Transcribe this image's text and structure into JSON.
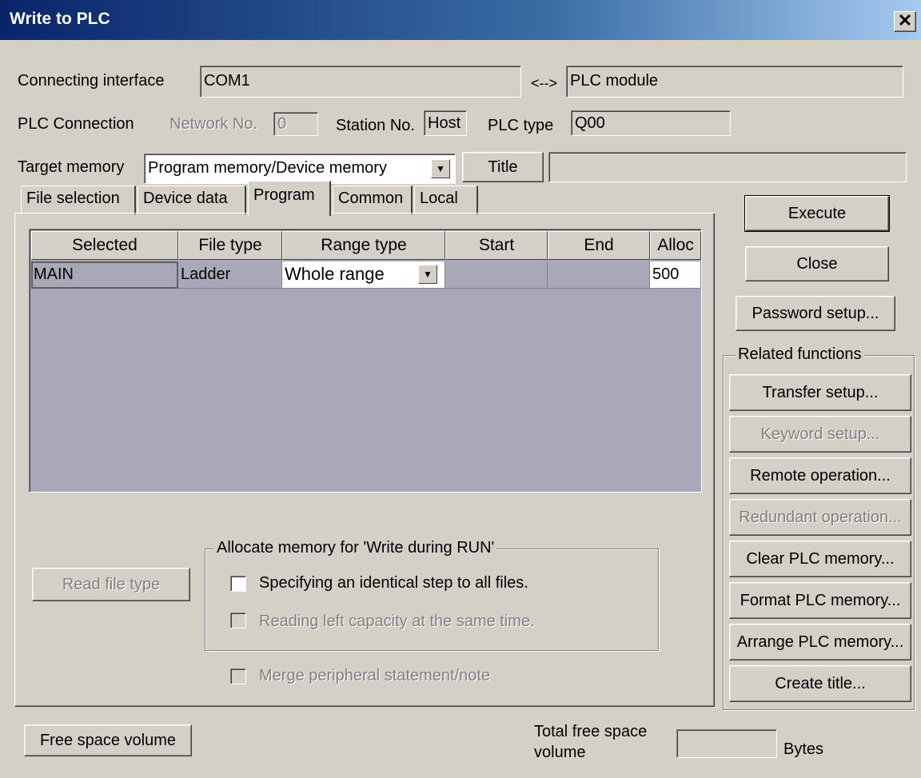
{
  "window": {
    "title": "Write to PLC",
    "close_glyph": "✕"
  },
  "connection": {
    "interface_label": "Connecting interface",
    "interface_value": "COM1",
    "arrow": "<-->",
    "module_value": "PLC module",
    "plc_connection_label": "PLC Connection",
    "network_label": "Network No.",
    "network_value": "0",
    "station_label": "Station No.",
    "station_value": "Host",
    "plc_type_label": "PLC type",
    "plc_type_value": "Q00"
  },
  "target": {
    "label": "Target memory",
    "value": "Program memory/Device memory",
    "title_button": "Title",
    "title_value": ""
  },
  "tabs": [
    "File selection",
    "Device data",
    "Program",
    "Common",
    "Local"
  ],
  "active_tab": "Program",
  "table": {
    "headers": [
      "Selected",
      "File type",
      "Range type",
      "Start",
      "End",
      "Alloc"
    ],
    "rows": [
      {
        "selected": "MAIN",
        "file_type": "Ladder",
        "range_type": "Whole range",
        "start": "",
        "end": "",
        "alloc": "500"
      }
    ]
  },
  "read_file_type_button": "Read file type",
  "allocate_group": {
    "title": "Allocate memory for 'Write during RUN'",
    "option1": "Specifying an identical step to all files.",
    "option2": "Reading left capacity at the same time."
  },
  "merge_option": "Merge peripheral statement/note",
  "side_buttons": {
    "execute": "Execute",
    "close": "Close",
    "password": "Password setup..."
  },
  "related": {
    "title": "Related functions",
    "buttons": [
      {
        "label": "Transfer setup...",
        "enabled": true
      },
      {
        "label": "Keyword setup...",
        "enabled": false
      },
      {
        "label": "Remote operation...",
        "enabled": true
      },
      {
        "label": "Redundant operation...",
        "enabled": false
      },
      {
        "label": "Clear PLC memory...",
        "enabled": true
      },
      {
        "label": "Format PLC memory...",
        "enabled": true
      },
      {
        "label": "Arrange PLC memory...",
        "enabled": true
      },
      {
        "label": "Create title...",
        "enabled": true
      }
    ]
  },
  "footer": {
    "free_space_button": "Free space volume",
    "total_label_line1": "Total free space",
    "total_label_line2": "volume",
    "total_value": "",
    "unit": "Bytes"
  },
  "icons": {
    "dropdown": "chevron-down-icon",
    "scroll_left": "arrow-left-icon",
    "scroll_right": "arrow-right-icon"
  }
}
